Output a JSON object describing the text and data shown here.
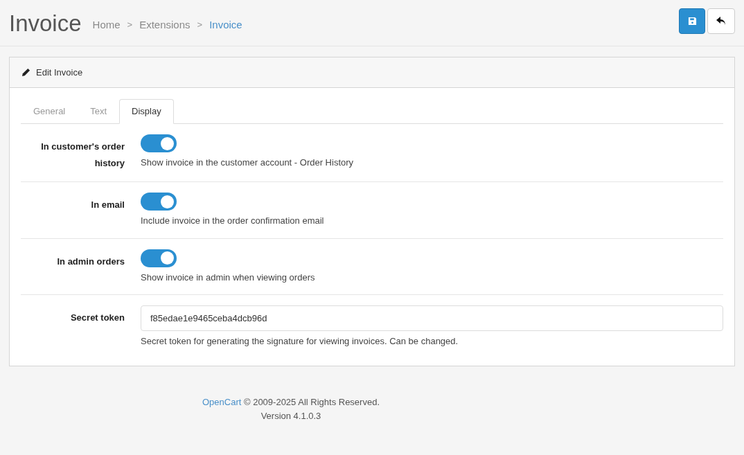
{
  "header": {
    "title": "Invoice",
    "breadcrumbs": [
      {
        "label": "Home",
        "current": false
      },
      {
        "label": "Extensions",
        "current": false
      },
      {
        "label": "Invoice",
        "current": true
      }
    ],
    "separator": ">"
  },
  "panel": {
    "title": "Edit Invoice",
    "tabs": [
      {
        "label": "General",
        "selected": false
      },
      {
        "label": "Text",
        "selected": false
      },
      {
        "label": "Display",
        "selected": true
      }
    ],
    "fields": [
      {
        "kind": "toggle",
        "label": "In customer's order history",
        "on": true,
        "help": "Show invoice in the customer account - Order History"
      },
      {
        "kind": "toggle",
        "label": "In email",
        "on": true,
        "help": "Include invoice in the order confirmation email"
      },
      {
        "kind": "toggle",
        "label": "In admin orders",
        "on": true,
        "help": "Show invoice in admin when viewing orders"
      },
      {
        "kind": "text",
        "label": "Secret token",
        "value": "f85edae1e9465ceba4dcb96d",
        "help": "Secret token for generating the signature for viewing invoices. Can be changed."
      }
    ]
  },
  "footer": {
    "link": "OpenCart",
    "text": " © 2009-2025 All Rights Reserved.",
    "version": "Version 4.1.0.3"
  }
}
